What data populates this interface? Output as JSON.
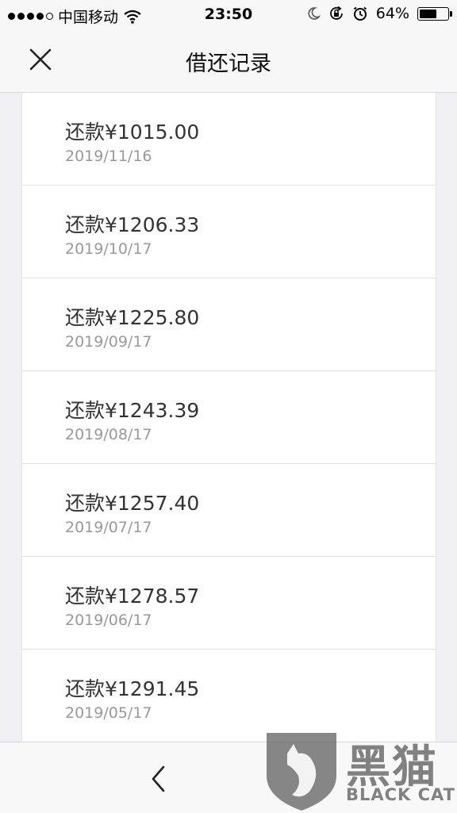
{
  "status_bar": {
    "carrier": "中国移动",
    "time": "23:50",
    "battery_percent": "64%",
    "battery_level": 0.64,
    "signal_dots_filled": 4,
    "signal_dots_total": 5,
    "icons": [
      "wifi-icon",
      "moon-icon",
      "orientation-lock-icon",
      "alarm-icon",
      "battery-icon"
    ]
  },
  "nav": {
    "title": "借还记录",
    "close_icon": "close-icon"
  },
  "records": [
    {
      "amount": "还款¥1015.00",
      "date": "2019/11/16"
    },
    {
      "amount": "还款¥1206.33",
      "date": "2019/10/17"
    },
    {
      "amount": "还款¥1225.80",
      "date": "2019/09/17"
    },
    {
      "amount": "还款¥1243.39",
      "date": "2019/08/17"
    },
    {
      "amount": "还款¥1257.40",
      "date": "2019/07/17"
    },
    {
      "amount": "还款¥1278.57",
      "date": "2019/06/17"
    },
    {
      "amount": "还款¥1291.45",
      "date": "2019/05/17"
    }
  ],
  "toolbar": {
    "back_icon": "chevron-left-icon",
    "forward_icon": "chevron-right-icon"
  },
  "watermark": {
    "cn": "黑猫",
    "en": "BLACK CAT"
  },
  "colors": {
    "background": "#efeff4",
    "bar": "#f7f7f7",
    "amount_text": "#333333",
    "date_text": "#999999"
  }
}
